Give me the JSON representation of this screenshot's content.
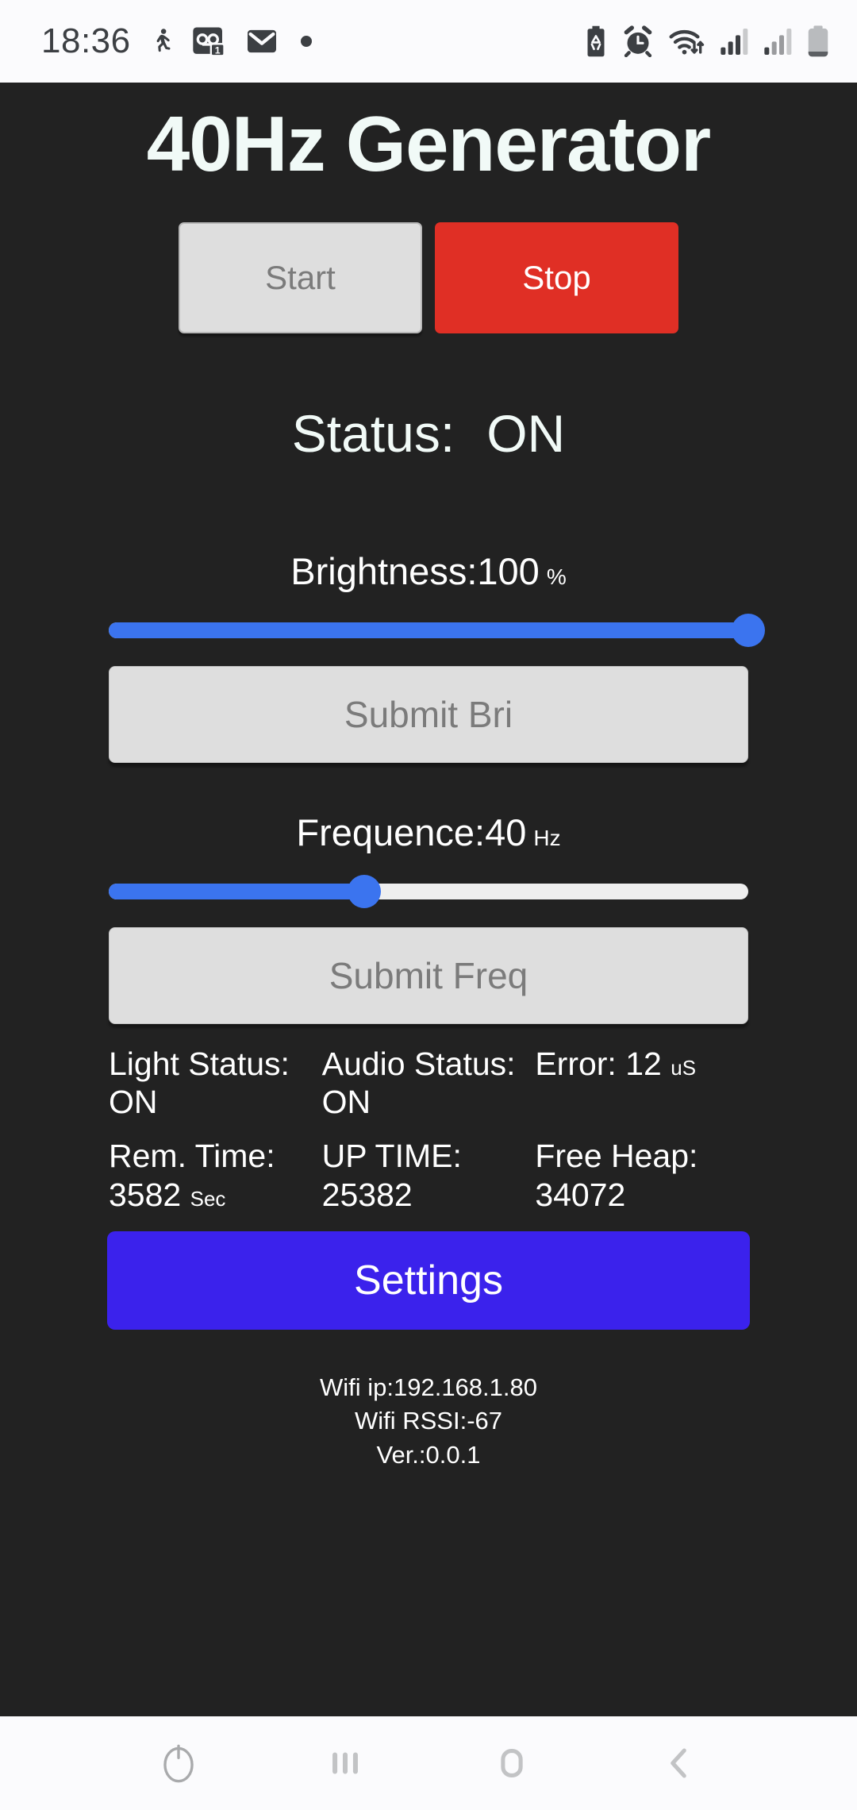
{
  "statusbar": {
    "clock": "18:36",
    "left_icons": [
      "walking-icon",
      "voicemail-icon",
      "email-icon",
      "dot-indicator-icon"
    ],
    "voicemail_badge": "1",
    "right_icons": [
      "battery-saver-icon",
      "alarm-icon",
      "wifi-icon",
      "signal-sim1-icon",
      "signal-sim2-icon",
      "battery-icon"
    ],
    "icon_color": "#3c3f43",
    "bg": "#fbfbfd"
  },
  "app": {
    "bg": "#222222",
    "title": "40Hz Generator",
    "title_color": "#f1faf7",
    "controls": {
      "start_label": "Start",
      "stop_label": "Stop",
      "start_disabled": true,
      "stop_color": "#e02f25"
    },
    "status": {
      "label": "Status:",
      "value": "ON"
    },
    "brightness": {
      "label": "Brightness:100",
      "unit": "%",
      "value": 100,
      "min": 0,
      "max": 100,
      "percent": 100,
      "submit_label": "Submit Bri",
      "accent": "#3b74ef"
    },
    "frequence": {
      "label": "Frequence:40",
      "unit": "Hz",
      "value": 40,
      "min": 0,
      "max": 100,
      "percent": 40,
      "submit_label": "Submit Freq",
      "accent": "#3b74ef"
    },
    "info": [
      {
        "label": "Light Status:",
        "value": "ON",
        "unit": ""
      },
      {
        "label": "Audio Status:",
        "value": "ON",
        "unit": ""
      },
      {
        "label": "Error:",
        "value": "12",
        "unit": "uS"
      },
      {
        "label": "Rem. Time:",
        "value": "3582",
        "unit": "Sec"
      },
      {
        "label": "UP TIME:",
        "value": "25382",
        "unit": ""
      },
      {
        "label": "Free Heap:",
        "value": "34072",
        "unit": ""
      }
    ],
    "info_cells": {
      "c0": "Light Status: ON",
      "c1": "Audio Status: ON",
      "c2a": "Error: 12",
      "c2b": "uS",
      "c3a": "Rem. Time: 3582",
      "c3b": "Sec",
      "c4": "UP TIME: 25382",
      "c5": "Free Heap: 34072"
    },
    "settings_label": "Settings",
    "settings_color": "#3b22ec",
    "footer": {
      "wifi_ip": "Wifi ip:192.168.1.80",
      "wifi_rssi": "Wifi RSSI:-67",
      "version": "Ver.:0.0.1"
    }
  },
  "navbar": {
    "items": [
      "power-icon",
      "recents-icon",
      "home-icon",
      "back-icon"
    ],
    "icon_color": "#b9babc",
    "bg": "#fbfbfd"
  }
}
